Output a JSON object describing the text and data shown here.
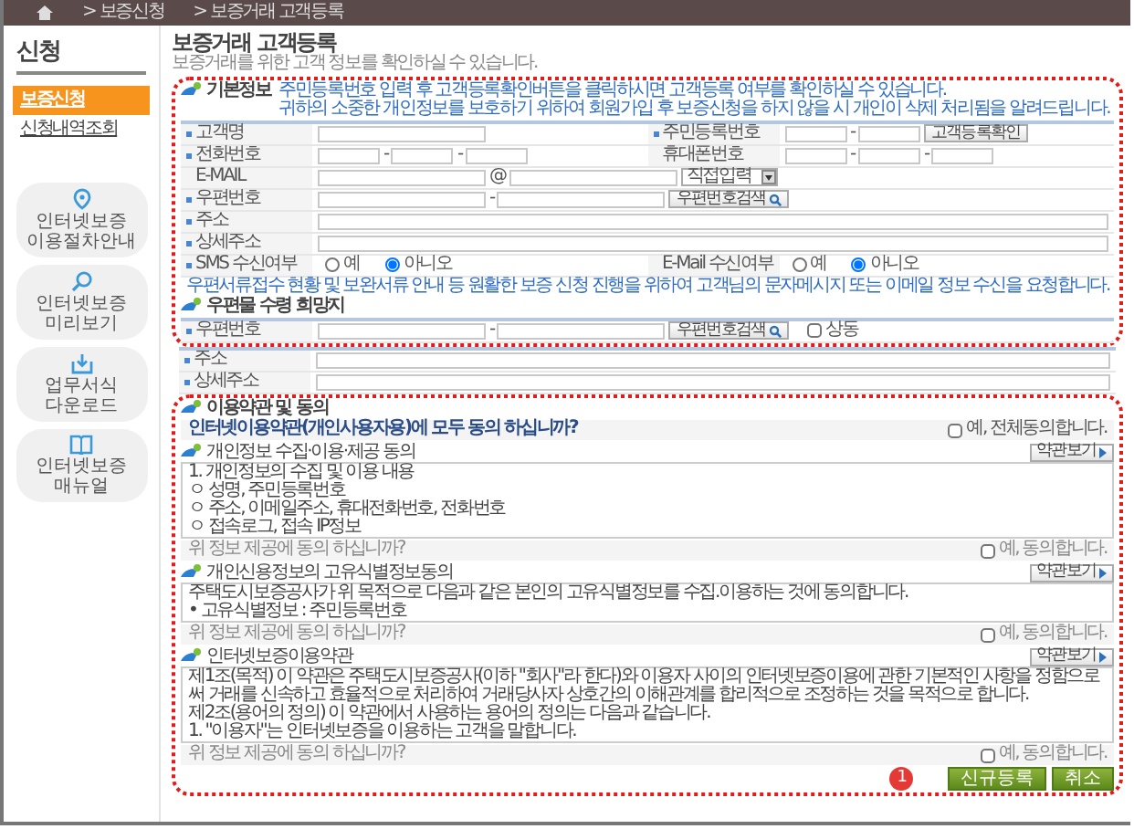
{
  "breadcrumb": [
    {
      "label": "> 보증신청"
    },
    {
      "label": "> 보증거래 고객등록"
    }
  ],
  "sidebar": {
    "title": "신청",
    "items": [
      {
        "label": "보증신청",
        "selected": true
      },
      {
        "label": "신청내역조회",
        "selected": false
      }
    ],
    "shortcuts": [
      {
        "kind": "pin",
        "label": "인터넷보증 이용절차안내"
      },
      {
        "kind": "search",
        "label": "인터넷보증 미리보기"
      },
      {
        "kind": "download",
        "label": "업무서식 다운로드"
      },
      {
        "kind": "book",
        "label": "인터넷보증 매뉴얼"
      }
    ]
  },
  "page": {
    "title": "보증거래 고객등록",
    "subtitle": "보증거래를 위한 고객 정보를 확인하실 수 있습니다."
  },
  "basic_info": {
    "heading": "기본정보",
    "notes": [
      "주민등록번호 입력 후 고객등록확인버튼을 클릭하시면 고객등록 여부를 확인하실 수 있습니다.",
      "귀하의 소중한 개인정보를 보호하기 위하여 회원가입 후 보증신청을 하지 않을 시 개인이 삭제 처리됨을 알려드립니다."
    ],
    "rows": [
      [
        {
          "label": "고객명",
          "required": true,
          "kind": "text"
        },
        {
          "label": "주민등록번호",
          "required": true,
          "kind": "id",
          "separator": "-",
          "button": "고객등록확인"
        }
      ],
      [
        {
          "label": "전화번호",
          "required": true,
          "kind": "phone",
          "separator": "-"
        },
        {
          "label": "휴대폰번호",
          "required": false,
          "kind": "phone",
          "separator": "-"
        }
      ],
      [
        {
          "label": "E-MAIL",
          "required": false,
          "kind": "email",
          "at": "@",
          "select": "직접입력"
        }
      ],
      [
        {
          "label": "우편번호",
          "required": true,
          "kind": "zip",
          "separator": "-",
          "button": "우편번호검색"
        }
      ],
      [
        {
          "label": "주소",
          "required": true,
          "kind": "wide"
        }
      ],
      [
        {
          "label": "상세주소",
          "required": true,
          "kind": "wide"
        }
      ],
      [
        {
          "label": "SMS 수신여부",
          "required": true,
          "kind": "radio",
          "options": [
            {
              "label": "예",
              "selected": false
            },
            {
              "label": "아니오",
              "selected": true
            }
          ]
        },
        {
          "label": "E-Mail 수신여부",
          "required": false,
          "kind": "radio",
          "options": [
            {
              "label": "예",
              "selected": false
            },
            {
              "label": "아니오",
              "selected": true
            }
          ]
        }
      ]
    ],
    "footnote": "우편서류접수 현황 및 보완서류 안내 등 원활한 보증 신청 진행을 위하여 고객님의 문자메시지 또는 이메일 정보 수신을 요청합니다."
  },
  "mail_address": {
    "heading": "우편물 수령 희망지",
    "rows": [
      [
        {
          "label": "우편번호",
          "required": true,
          "kind": "zip",
          "separator": "-",
          "button": "우편번호검색",
          "checkbox": {
            "label": "상동",
            "checked": false
          }
        }
      ],
      [
        {
          "label": "주소",
          "required": true,
          "kind": "wide"
        }
      ],
      [
        {
          "label": "상세주소",
          "required": true,
          "kind": "wide"
        }
      ]
    ]
  },
  "agreement": {
    "heading": "이용약관 및 동의",
    "all_agree": {
      "question": "인터넷이용약관(개인사용자용)에 모두 동의 하십니까?",
      "checkbox": {
        "label": "예, 전체동의합니다.",
        "checked": false
      }
    },
    "terms": [
      {
        "heading": "개인정보 수집·이용·제공 동의",
        "view_button": "약관보기",
        "lines": [
          "1. 개인정보의 수집 및 이용 내용",
          "ㅇ 성명, 주민등록번호",
          "ㅇ 주소, 이메일주소, 휴대전화번호, 전화번호",
          "ㅇ 접속로그, 접속 IP정보"
        ],
        "question": "위 정보 제공에 동의 하십니까?",
        "checkbox": {
          "label": "예, 동의합니다.",
          "checked": false
        }
      },
      {
        "heading": "개인신용정보의 고유식별정보동의",
        "view_button": "약관보기",
        "lines": [
          "주택도시보증공사가 위 목적으로 다음과 같은 본인의 고유식별정보를 수집.이용하는 것에 동의합니다.",
          "• 고유식별정보 : 주민등록번호"
        ],
        "question": "위 정보 제공에 동의 하십니까?",
        "checkbox": {
          "label": "예, 동의합니다.",
          "checked": false
        }
      },
      {
        "heading": "인터넷보증이용약관",
        "view_button": "약관보기",
        "lines": [
          "제1조(목적) 이 약관은 주택도시보증공사(이하 \"회사\"라 한다)와 이용자 사이의 인터넷보증이용에 관한 기본적인 사항을 정함으로써 거래를 신속하고 효율적으로 처리하여 거래당사자 상호간의 이해관계를 합리적으로 조정하는 것을 목적으로 합니다.",
          "제2조(용어의 정의) 이 약관에서 사용하는 용어의 정의는 다음과 같습니다.",
          "1. \"이용자\"는 인터넷보증을 이용하는 고객을 말합니다."
        ],
        "question": "위 정보 제공에 동의 하십니까?",
        "checkbox": {
          "label": "예, 동의합니다.",
          "checked": false
        }
      }
    ]
  },
  "actions": {
    "marker": "1",
    "buttons": [
      {
        "label": "신규등록"
      },
      {
        "label": "취소"
      }
    ]
  }
}
